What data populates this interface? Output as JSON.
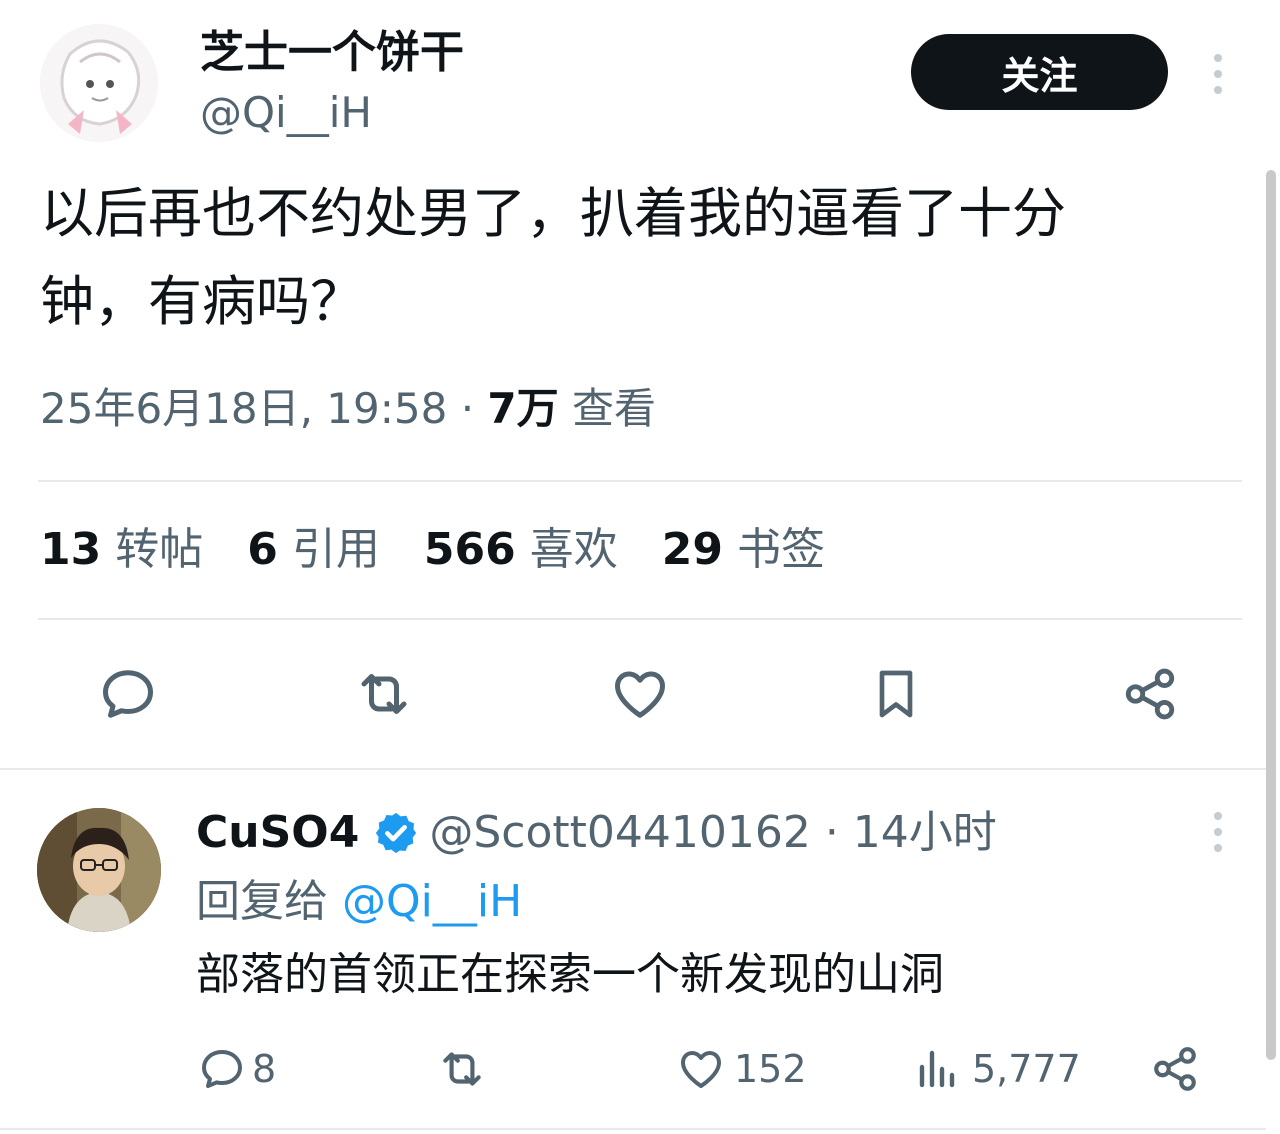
{
  "tweet": {
    "display_name": "芝士一个饼干",
    "handle": "@Qi__iH",
    "follow_label": "关注",
    "text_line1": "以后再也不约处男了，扒着我的逼看了十分",
    "text_line2": "钟，有病吗？",
    "timestamp": "25年6月18日, 19:58 · ",
    "views_count": "7万",
    "views_label": " 查看",
    "stats": {
      "retweets_count": "13",
      "retweets_label": "转帖",
      "quotes_count": "6",
      "quotes_label": "引用",
      "likes_count": "566",
      "likes_label": "喜欢",
      "bookmarks_count": "29",
      "bookmarks_label": "书签"
    }
  },
  "reply": {
    "display_name": "CuSO4",
    "handle_time": "@Scott04410162 · 14小时",
    "replying_prefix": "回复给 ",
    "replying_to": "@Qi__iH",
    "text": "部落的首领正在探索一个新发现的山洞",
    "actions": {
      "replies": "8",
      "likes": "152",
      "views": "5,777"
    }
  },
  "colors": {
    "text": "#0f1419",
    "muted": "#536471",
    "link": "#1d9bf0",
    "verified": "#1d9bf0",
    "divider": "#e7e9ea"
  },
  "icons": [
    "reply-icon",
    "retweet-icon",
    "like-icon",
    "bookmark-icon",
    "share-icon",
    "verified-badge-icon",
    "views-icon",
    "more-icon"
  ]
}
